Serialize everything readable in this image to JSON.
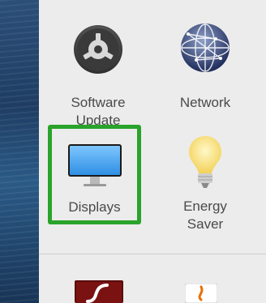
{
  "prefs": {
    "software_update": {
      "label": "Software\nUpdate",
      "icon": "gear-icon"
    },
    "network": {
      "label": "Network",
      "icon": "globe-network-icon"
    },
    "displays": {
      "label": "Displays",
      "icon": "display-monitor-icon",
      "highlight_color": "#2aa32b"
    },
    "energy_saver": {
      "label": "Energy\nSaver",
      "icon": "lightbulb-icon"
    },
    "flash_player": {
      "icon": "flash-player-icon"
    },
    "java": {
      "icon": "java-icon"
    }
  }
}
